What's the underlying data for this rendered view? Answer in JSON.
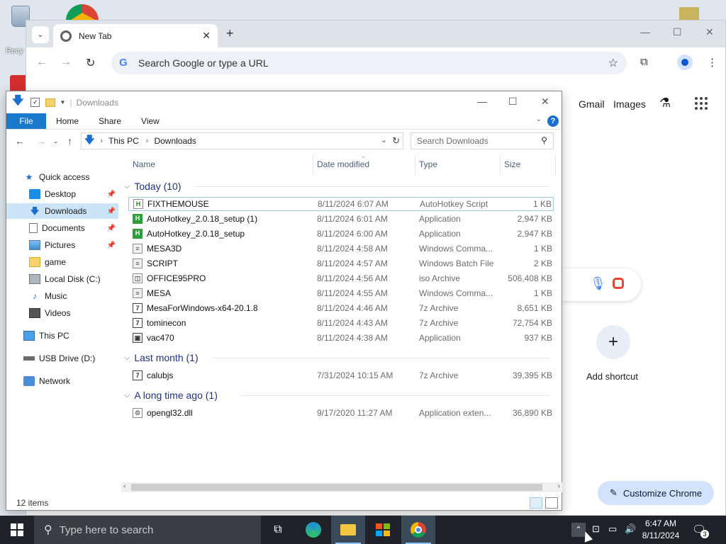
{
  "desktop": {
    "recycle_label": "Recy"
  },
  "chrome": {
    "tab_title": "New Tab",
    "omnibox_placeholder": "Search Google or type a URL",
    "ntp": {
      "gmail": "Gmail",
      "images": "Images",
      "add_shortcut": "Add shortcut",
      "customize": "Customize Chrome"
    }
  },
  "explorer": {
    "title": "Downloads",
    "ribbon": {
      "file": "File",
      "home": "Home",
      "share": "Share",
      "view": "View"
    },
    "address": {
      "this_pc": "This PC",
      "downloads": "Downloads"
    },
    "search_placeholder": "Search Downloads",
    "nav": [
      {
        "label": "Quick access",
        "icon": "star-icon"
      },
      {
        "label": "Desktop",
        "icon": "desktop-icon",
        "pinned": true
      },
      {
        "label": "Downloads",
        "icon": "download-icon",
        "pinned": true,
        "selected": true
      },
      {
        "label": "Documents",
        "icon": "documents-icon",
        "pinned": true
      },
      {
        "label": "Pictures",
        "icon": "pictures-icon",
        "pinned": true
      },
      {
        "label": "game",
        "icon": "folder-icon"
      },
      {
        "label": "Local Disk (C:)",
        "icon": "disk-icon"
      },
      {
        "label": "Music",
        "icon": "music-icon"
      },
      {
        "label": "Videos",
        "icon": "videos-icon"
      },
      {
        "label": "This PC",
        "icon": "pc-icon"
      },
      {
        "label": "USB Drive (D:)",
        "icon": "usb-drive-icon"
      },
      {
        "label": "Network",
        "icon": "network-icon"
      }
    ],
    "columns": {
      "name": "Name",
      "date": "Date modified",
      "type": "Type",
      "size": "Size"
    },
    "groups": [
      {
        "label": "Today (10)"
      },
      {
        "label": "Last month (1)"
      },
      {
        "label": "A long time ago (1)"
      }
    ],
    "files": [
      {
        "name": "FIXTHEMOUSE",
        "date": "8/11/2024 6:07 AM",
        "type": "AutoHotkey Script",
        "size": "1 KB",
        "icon": "ahk",
        "glyph": "H"
      },
      {
        "name": "AutoHotkey_2.0.18_setup (1)",
        "date": "8/11/2024 6:01 AM",
        "type": "Application",
        "size": "2,947 KB",
        "icon": "app",
        "glyph": "H"
      },
      {
        "name": "AutoHotkey_2.0.18_setup",
        "date": "8/11/2024 6:00 AM",
        "type": "Application",
        "size": "2,947 KB",
        "icon": "app",
        "glyph": "H"
      },
      {
        "name": "MESA3D",
        "date": "8/11/2024 4:58 AM",
        "type": "Windows Comma...",
        "size": "1 KB",
        "icon": "cmd",
        "glyph": "≡"
      },
      {
        "name": "SCRIPT",
        "date": "8/11/2024 4:57 AM",
        "type": "Windows Batch File",
        "size": "2 KB",
        "icon": "cmd",
        "glyph": "≡"
      },
      {
        "name": "OFFICE95PRO",
        "date": "8/11/2024 4:56 AM",
        "type": "iso Archive",
        "size": "506,408 KB",
        "icon": "iso",
        "glyph": "◫"
      },
      {
        "name": "MESA",
        "date": "8/11/2024 4:55 AM",
        "type": "Windows Comma...",
        "size": "1 KB",
        "icon": "cmd",
        "glyph": "≡"
      },
      {
        "name": "MesaForWindows-x64-20.1.8",
        "date": "8/11/2024 4:46 AM",
        "type": "7z Archive",
        "size": "8,651 KB",
        "icon": "7z",
        "glyph": "7"
      },
      {
        "name": "tominecon",
        "date": "8/11/2024 4:43 AM",
        "type": "7z Archive",
        "size": "72,754 KB",
        "icon": "7z",
        "glyph": "7"
      },
      {
        "name": "vac470",
        "date": "8/11/2024 4:38 AM",
        "type": "Application",
        "size": "937 KB",
        "icon": "vac",
        "glyph": "▣"
      },
      {
        "name": "calubjs",
        "date": "7/31/2024 10:15 AM",
        "type": "7z Archive",
        "size": "39,395 KB",
        "icon": "7z",
        "glyph": "7"
      },
      {
        "name": "opengl32.dll",
        "date": "9/17/2020 11:27 AM",
        "type": "Application exten...",
        "size": "36,890 KB",
        "icon": "dll",
        "glyph": "⚙"
      }
    ],
    "status": "12 items"
  },
  "taskbar": {
    "search_placeholder": "Type here to search",
    "time": "6:47 AM",
    "date": "8/11/2024",
    "notifications": "3"
  }
}
